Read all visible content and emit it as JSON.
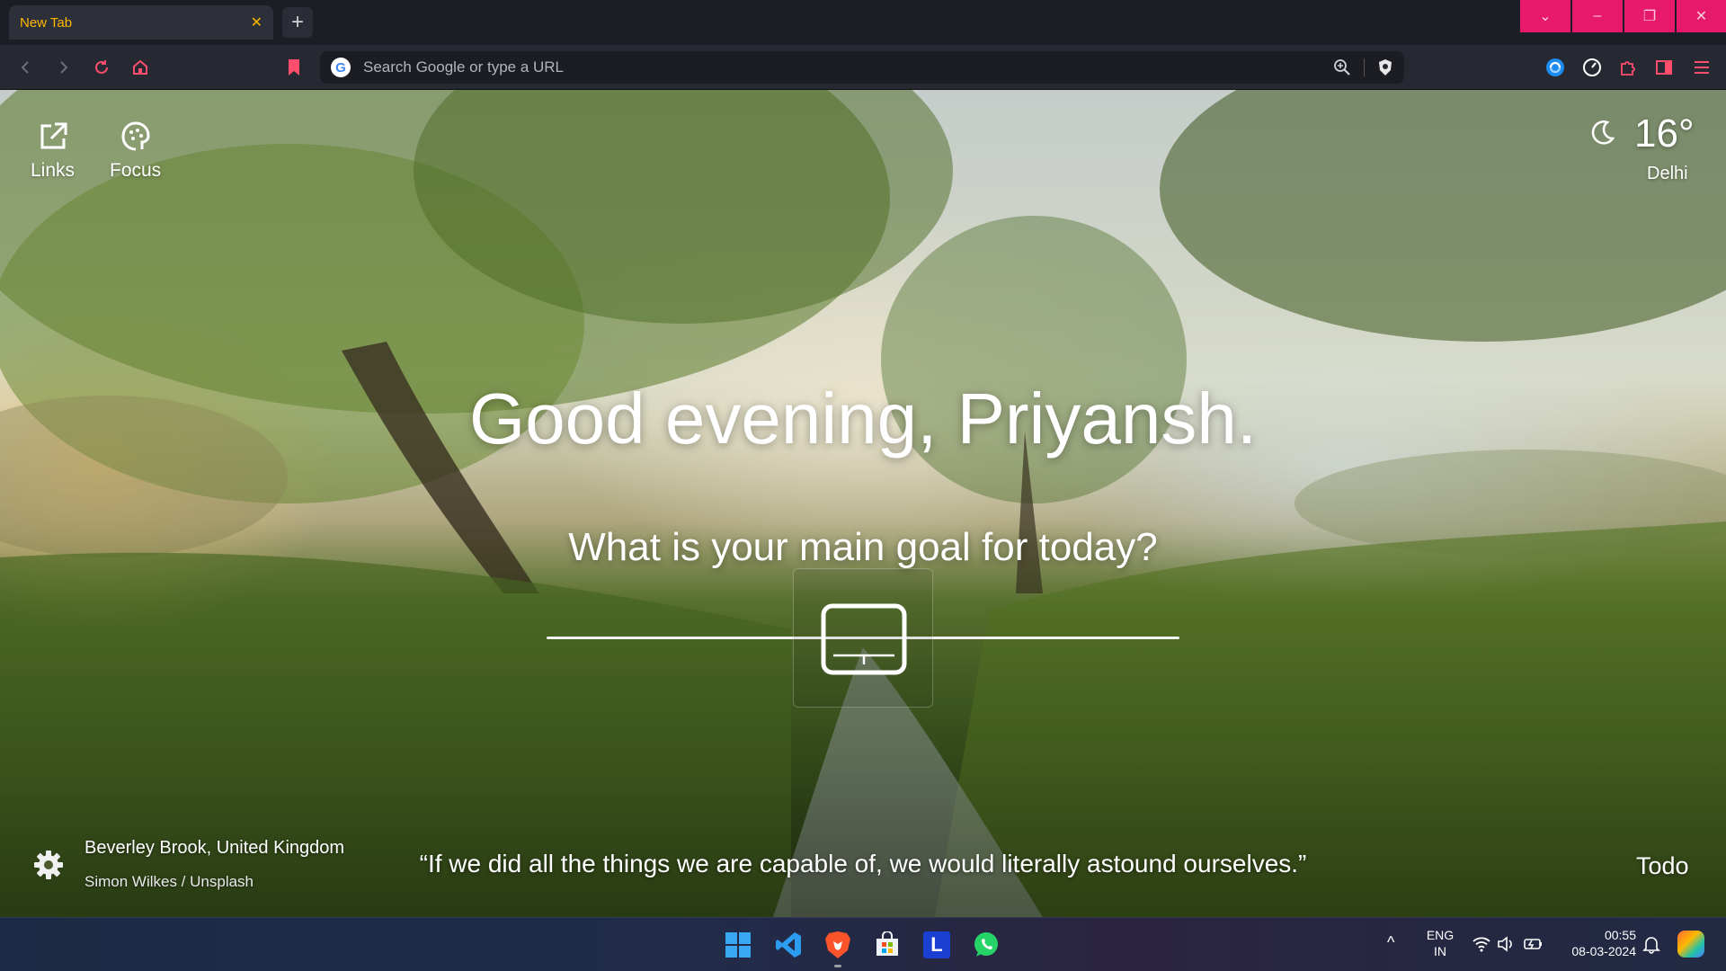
{
  "browser": {
    "tab_title": "New Tab",
    "tab_close": "✕",
    "new_tab": "+",
    "omnibox_placeholder": "Search Google or type a URL",
    "window_controls": {
      "dropdown": "⌄",
      "minimize": "–",
      "restore": "❐",
      "close": "✕"
    }
  },
  "top_left": [
    {
      "label": "Links",
      "icon": "external-link-icon"
    },
    {
      "label": "Focus",
      "icon": "brain-icon"
    }
  ],
  "weather": {
    "temp": "16°",
    "city": "Delhi",
    "icon": "moon-icon"
  },
  "greeting": "Good evening, Priyansh.",
  "goal_question": "What is your main goal for today?",
  "photo": {
    "location": "Beverley Brook, United Kingdom",
    "credit": "Simon Wilkes / Unsplash"
  },
  "quote": "“If we did all the things we are capable of, we would literally astound ourselves.”",
  "todo": "Todo",
  "taskbar": {
    "apps": [
      "start-icon",
      "vscode-icon",
      "brave-icon",
      "store-icon",
      "l-app-icon",
      "whatsapp-icon"
    ],
    "lang1": "ENG",
    "lang2": "IN",
    "time": "00:55",
    "date": "08-03-2024",
    "chevron": "^"
  },
  "colors": {
    "accent": "#ffb800",
    "window_controls": "#e6196a",
    "bookmark": "#ff4d6d"
  }
}
